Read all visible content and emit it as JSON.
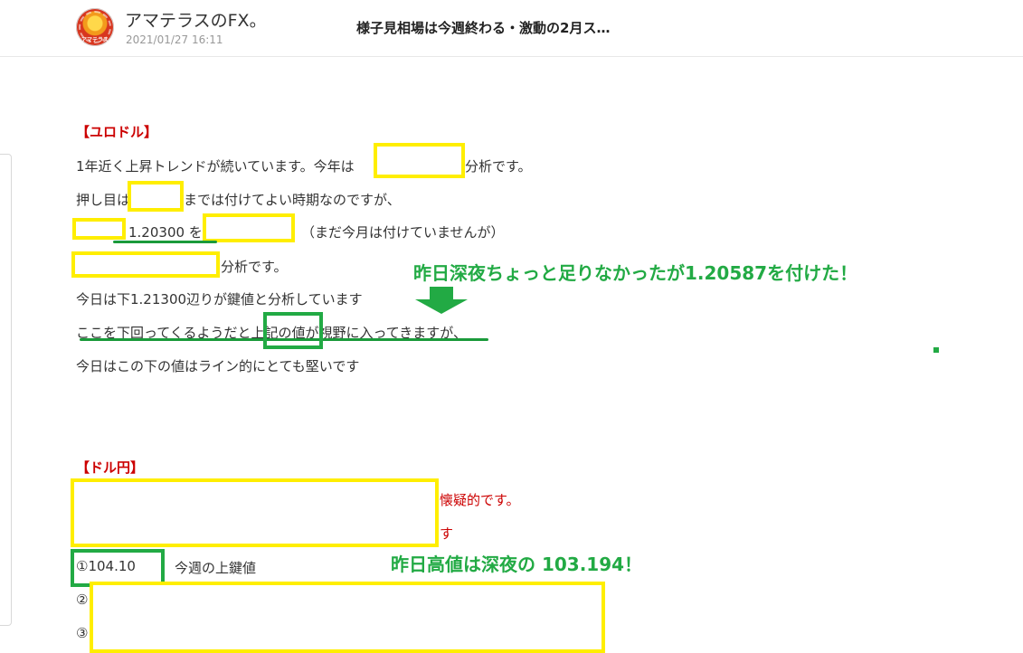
{
  "header": {
    "avatar_text": "アマテラス",
    "author": "アマテラスのFX。",
    "date": "2021/01/27 16:11",
    "title": "様子見相場は今週終わる・激動の2月ス…"
  },
  "eurusd": {
    "heading": "【ユロドル】",
    "line1_pre": "1年近く上昇トレンドが続いています。今年は",
    "line1_post": "分析です。",
    "line2_pre": "押し目は",
    "line2_post": "までは付けてよい時期なのですが、",
    "line3_value": "1.20300 を",
    "line3_post": "（まだ今月は付けていませんが）",
    "line4_post": "分析です。",
    "line5": "今日は下1.21300辺りが鍵値と分析しています",
    "line6": "ここを下回ってくるようだと上記の値が視野に入ってきますが、",
    "line7": "今日はこの下の値はライン的にとても堅いです",
    "note": "昨日深夜ちょっと足りなかったが1.20587を付けた！"
  },
  "usdjpy": {
    "heading": "【ドル円】",
    "line1_post": "懐疑的です。",
    "line2_post": "す",
    "item1_value": "①104.10",
    "item1_label": "今週の上鍵値",
    "item2_marker": "②",
    "item3_marker": "③",
    "note": "昨日高値は深夜の 103.194！"
  },
  "colors": {
    "highlight_yellow": "#ffee00",
    "annotation_green": "#22aa44",
    "heading_red": "#cc0000"
  }
}
